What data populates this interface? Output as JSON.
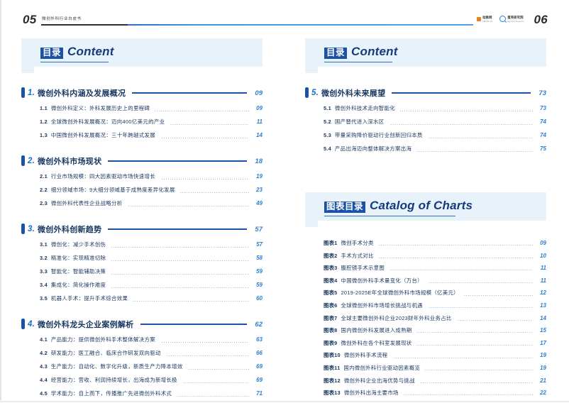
{
  "header": {
    "folio_left": "05",
    "doc_title": "微创外科行业白皮书",
    "folio_right": "06",
    "logos": [
      {
        "name": "publisher-logo",
        "top": "动脉网",
        "bottom": "VBDATA.CN"
      },
      {
        "name": "research-institute-logo",
        "top": "蛋壳研究院",
        "bottom": "Egg Shell Research"
      }
    ]
  },
  "left_column": {
    "banner": {
      "cn": "目录",
      "en": "Content",
      "underline_width": 96
    },
    "sections": [
      {
        "num": "1.",
        "title": "微创外科内涵及发展概况",
        "page": "09",
        "rule_flex": true,
        "subs": [
          {
            "num": "1.1",
            "title": "微创外科定义：外科发展历史上的里程碑",
            "page": "09"
          },
          {
            "num": "1.2",
            "title": "全球微创外科发展概况：迈向400亿美元的产业",
            "page": "11"
          },
          {
            "num": "1.3",
            "title": "中国微创外科发展概况：三十年跨越式发展",
            "page": "14"
          }
        ]
      },
      {
        "num": "2.",
        "title": "微创外科市场现状",
        "page": "18",
        "subs": [
          {
            "num": "2.1",
            "title": "行业市场规模：四大因素驱动市场快速增长",
            "page": "19"
          },
          {
            "num": "2.2",
            "title": "细分领域市场：9大细分领域基于成熟度差异化发展",
            "page": "23"
          },
          {
            "num": "2.3",
            "title": "微创外科代表性企业战略分析",
            "page": "49"
          }
        ]
      },
      {
        "num": "3.",
        "title": "微创外科创新趋势",
        "page": "57",
        "subs": [
          {
            "num": "3.1",
            "title": "微创化：减少手术创伤",
            "page": "57"
          },
          {
            "num": "3.2",
            "title": "精准化：实现精准切除",
            "page": "58"
          },
          {
            "num": "3.3",
            "title": "智能化：智能辅助决策",
            "page": "59"
          },
          {
            "num": "3.4",
            "title": "集成化：简化操作难度",
            "page": "59"
          },
          {
            "num": "3.5",
            "title": "机器人手术：提升手术综合效果",
            "page": "60"
          }
        ]
      },
      {
        "num": "4.",
        "title": "微创外科龙头企业案例解析",
        "page": "62",
        "subs": [
          {
            "num": "4.1",
            "title": "产品能力：提供微创外科手术整体解决方案",
            "page": "63"
          },
          {
            "num": "4.2",
            "title": "研发能力：医工融合、临床合作研发双向驱动",
            "page": "66"
          },
          {
            "num": "4.3",
            "title": "生产能力：自动化、数字化升级，新质生产力降本增效",
            "page": "69"
          },
          {
            "num": "4.4",
            "title": "经营能力：营收、利润持续增长，出海成为新增长极",
            "page": "69"
          },
          {
            "num": "4.5",
            "title": "学术能力：自上而下，传播推广先进微创外科术式",
            "page": "71"
          }
        ]
      }
    ]
  },
  "right_column": {
    "banner": {
      "cn": "目录",
      "en": "Content",
      "underline_width": 96
    },
    "sections": [
      {
        "num": "5.",
        "title": "微创外科未来展望",
        "page": "73",
        "subs": [
          {
            "num": "5.1",
            "title": "微创外科技术走向智能化",
            "page": "73"
          },
          {
            "num": "5.2",
            "title": "国产替代进入深水区",
            "page": "74"
          },
          {
            "num": "5.3",
            "title": "带量采购降价驱动行业创新回归本质",
            "page": "74"
          },
          {
            "num": "5.4",
            "title": "产品出海迈向整体解决方案出海",
            "page": "75"
          }
        ]
      }
    ],
    "charts_banner": {
      "cn": "图表目录",
      "en": "Catalog of Charts",
      "underline_width": 185
    },
    "charts": [
      {
        "label": "图表1",
        "title": "微创手术分类",
        "page": "09"
      },
      {
        "label": "图表2",
        "title": "手术方式对比",
        "page": "10"
      },
      {
        "label": "图表3",
        "title": "腹腔镜手术示意图",
        "page": "11"
      },
      {
        "label": "图表4",
        "title": "中国微创外科手术量变化（万台）",
        "page": "11"
      },
      {
        "label": "图表5",
        "title": "2019-2025E年全球微创外科市场规模（亿美元）",
        "page": "12"
      },
      {
        "label": "图表6",
        "title": "全球微创外科市场增长挑战与机遇",
        "page": "13"
      },
      {
        "label": "图表7",
        "title": "全球主要微创外科企业2023财年外科业务占比",
        "page": "14"
      },
      {
        "label": "图表8",
        "title": "国内微创外科发展进入成熟期",
        "page": "15"
      },
      {
        "label": "图表9",
        "title": "微创外科在各个科室发展现状",
        "page": "17"
      },
      {
        "label": "图表10",
        "title": "微创外科手术流程",
        "page": "19"
      },
      {
        "label": "图表11",
        "title": "国内微创外科行业驱动因素概览",
        "page": "19"
      },
      {
        "label": "图表12",
        "title": "微创外科企业出海优势与挑战",
        "page": "21"
      },
      {
        "label": "图表13",
        "title": "微创外科出海主要市场",
        "page": "22"
      }
    ]
  },
  "colors": {
    "accent_blue": "#1b52a6",
    "light_blue_panel": "#e8f2fb",
    "page_number_blue": "#2f7fd0",
    "text_navy": "#1b3a63"
  }
}
